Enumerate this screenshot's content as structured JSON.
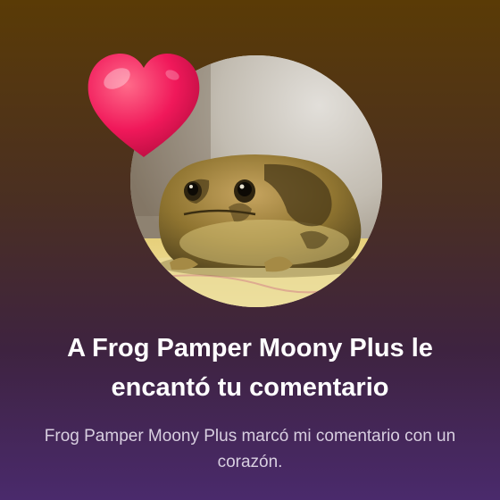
{
  "notification": {
    "title": "A Frog Pamper Moony Plus le encantó tu comentario",
    "message": "Frog Pamper Moony Plus marcó mi comentario con un corazón."
  },
  "avatar": {
    "subject": "frog-photo"
  },
  "icons": {
    "reaction": "heart-icon"
  },
  "colors": {
    "background_top": "#5a3b06",
    "background_bottom": "#4a2a6c",
    "heart": "#f0185a",
    "title_text": "#ffffff",
    "message_text": "#d8cfe0"
  }
}
